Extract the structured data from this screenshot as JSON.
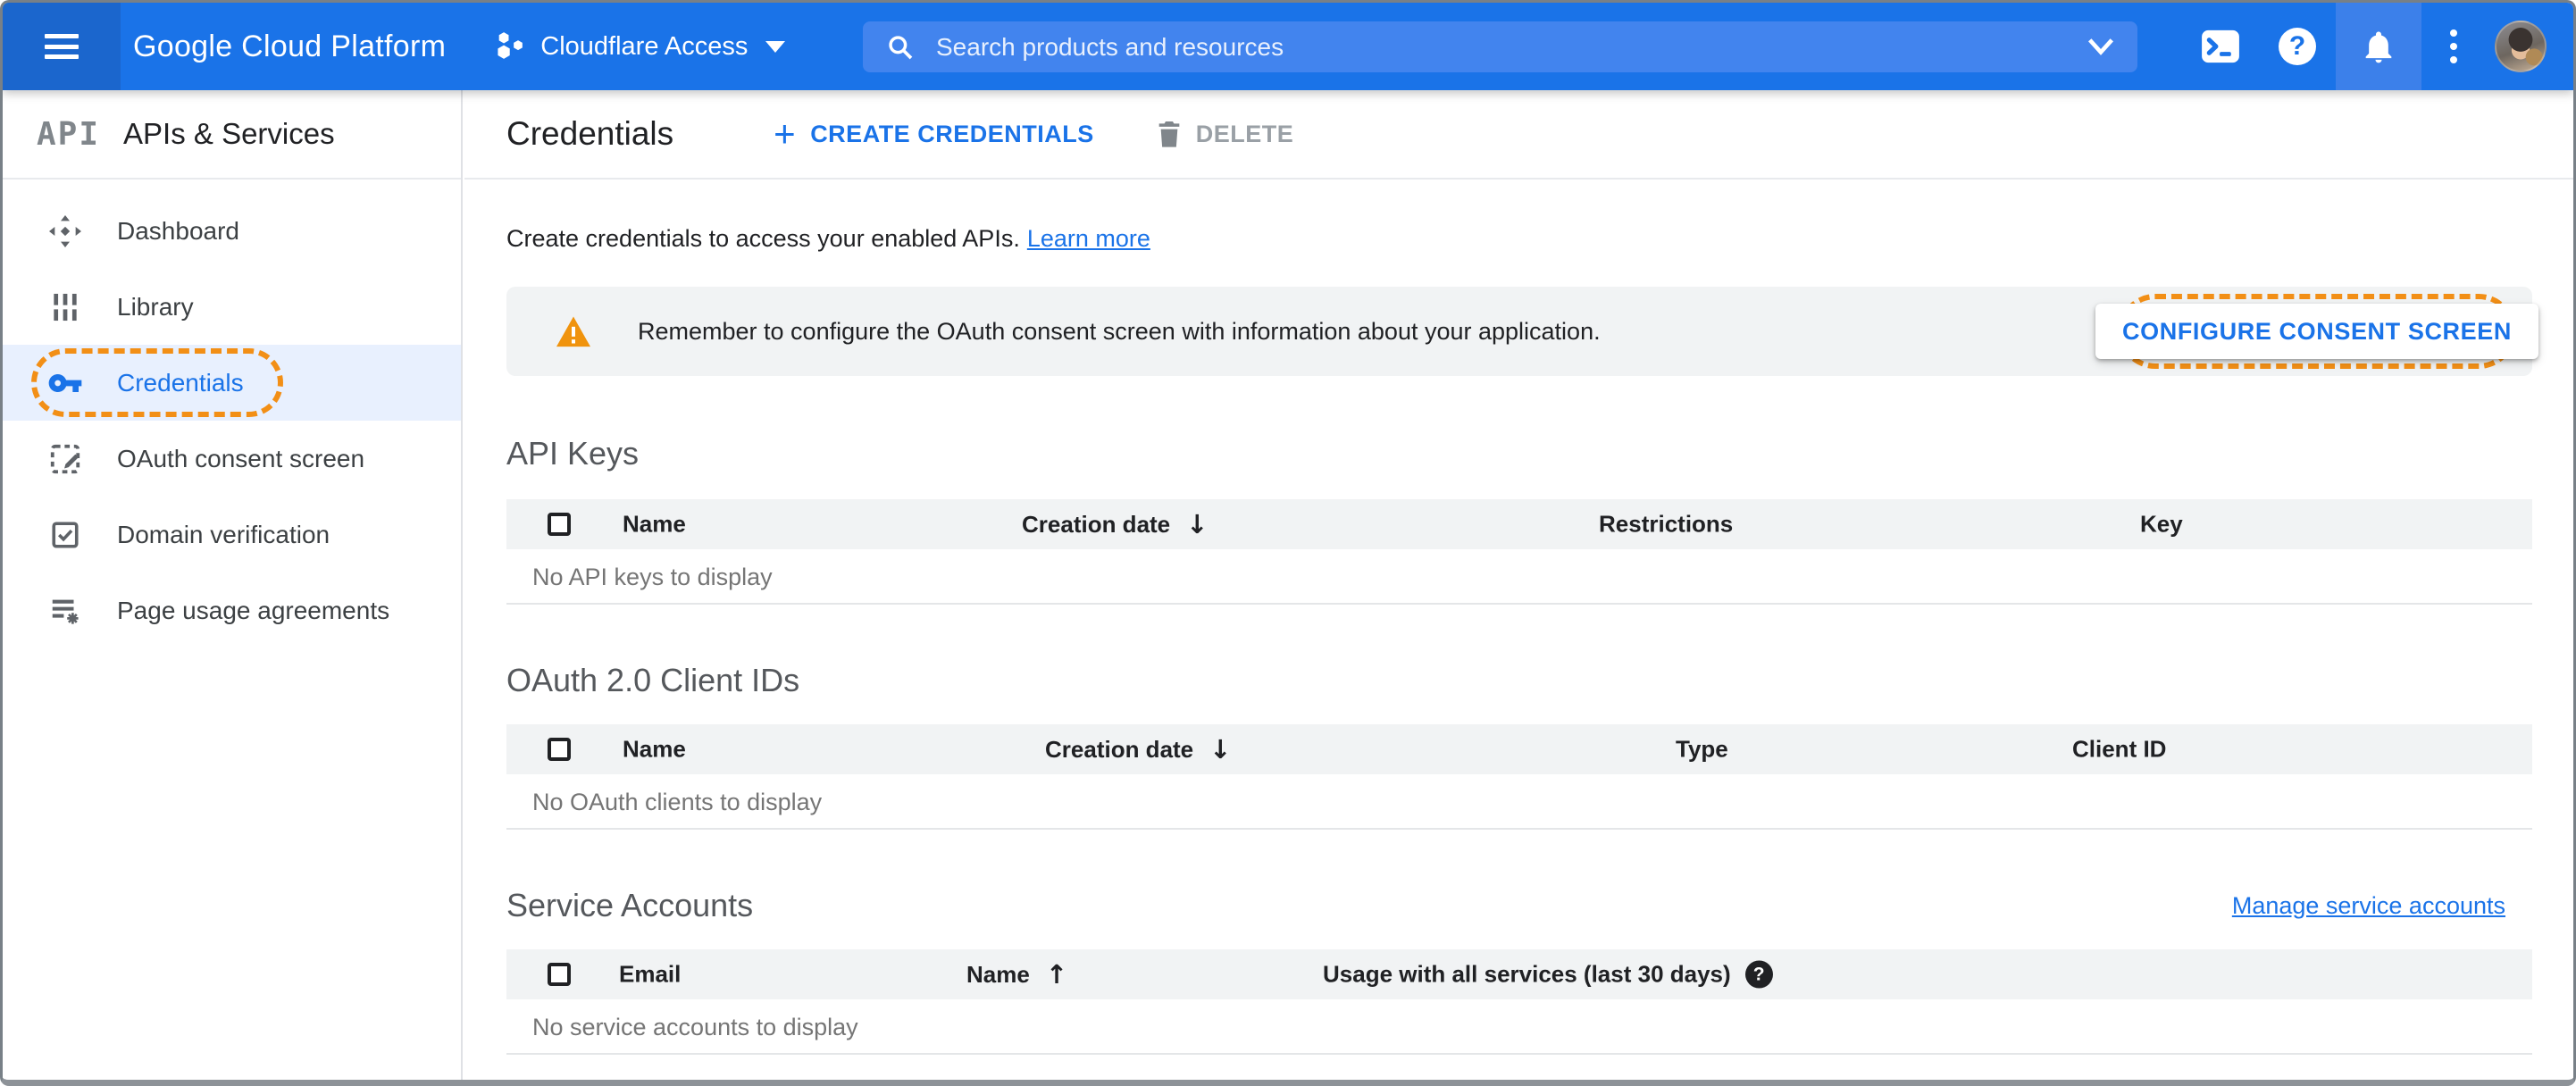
{
  "topbar": {
    "logo": "Google Cloud Platform",
    "project_selector": "Cloudflare Access",
    "search_placeholder": "Search products and resources"
  },
  "sidebar": {
    "product_logo": "API",
    "title": "APIs & Services",
    "items": [
      {
        "label": "Dashboard",
        "selected": false
      },
      {
        "label": "Library",
        "selected": false
      },
      {
        "label": "Credentials",
        "selected": true,
        "tutorial_highlight": true
      },
      {
        "label": "OAuth consent screen",
        "selected": false
      },
      {
        "label": "Domain verification",
        "selected": false
      },
      {
        "label": "Page usage agreements",
        "selected": false
      }
    ]
  },
  "header": {
    "title": "Credentials",
    "create_label": "CREATE CREDENTIALS",
    "delete_label": "DELETE"
  },
  "intro": {
    "text": "Create credentials to access your enabled APIs.",
    "link": "Learn more"
  },
  "banner": {
    "message": "Remember to configure the OAuth consent screen with information about your application.",
    "button": "CONFIGURE CONSENT SCREEN"
  },
  "sections": {
    "api_keys": {
      "title": "API Keys",
      "columns": [
        "Name",
        "Creation date",
        "Restrictions",
        "Key"
      ],
      "sort": {
        "column": "Creation date",
        "direction": "desc"
      },
      "empty": "No API keys to display"
    },
    "oauth_clients": {
      "title": "OAuth 2.0 Client IDs",
      "columns": [
        "Name",
        "Creation date",
        "Type",
        "Client ID"
      ],
      "sort": {
        "column": "Creation date",
        "direction": "desc"
      },
      "empty": "No OAuth clients to display"
    },
    "service_accounts": {
      "title": "Service Accounts",
      "manage_link": "Manage service accounts",
      "columns": [
        "Email",
        "Name",
        "Usage with all services (last 30 days)"
      ],
      "sort": {
        "column": "Name",
        "direction": "asc"
      },
      "empty": "No service accounts to display"
    }
  },
  "icons": {
    "sort_desc": "↓",
    "sort_asc": "↑",
    "plus": "+",
    "help_badge": "?",
    "help_circle": "?"
  },
  "colors": {
    "topbar_blue": "#1a73e8",
    "topbar_dark_blue": "#1b66cd",
    "accent_blue": "#1a73e8",
    "tutorial_orange": "#f28f16",
    "selected_item_bg": "#e8f0fe",
    "banner_bg": "#f1f3f4",
    "table_header_bg": "#f1f3f4",
    "warning_orange": "#f0930d"
  }
}
